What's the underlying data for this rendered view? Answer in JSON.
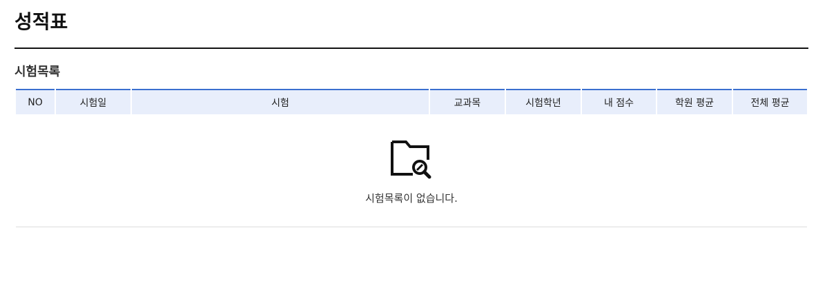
{
  "page": {
    "title": "성적표"
  },
  "section": {
    "title": "시험목록"
  },
  "table": {
    "headers": [
      "NO",
      "시험일",
      "시험",
      "교과목",
      "시험학년",
      "내 점수",
      "학원 평균",
      "전체 평균"
    ]
  },
  "empty_state": {
    "icon": "folder-search-icon",
    "message": "시험목록이 없습니다."
  },
  "colors": {
    "accent": "#3a6fd0",
    "header_bg": "#e8eefb",
    "title_rule": "#111111"
  }
}
